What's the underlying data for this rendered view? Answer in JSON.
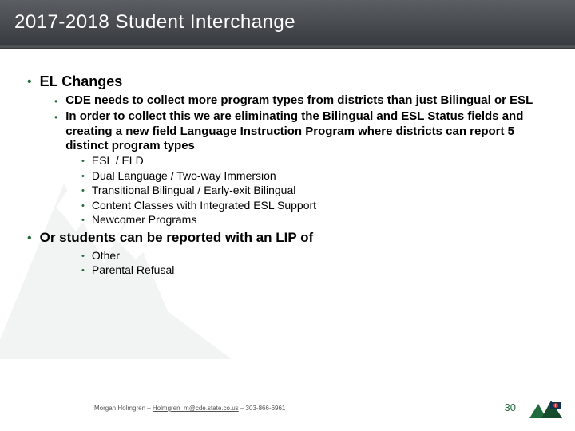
{
  "title": "2017-2018 Student Interchange",
  "bullets1": [
    {
      "text": "EL Changes"
    }
  ],
  "bullets2a": [
    {
      "text": "CDE needs to collect more program types from districts than just Bilingual or ESL"
    },
    {
      "text": "In order to collect this we are eliminating the Bilingual and ESL Status fields and creating a new field Language Instruction Program where districts can report 5 distinct program types"
    }
  ],
  "bullets3a": [
    {
      "text": "ESL / ELD"
    },
    {
      "text": "Dual Language / Two-way Immersion"
    },
    {
      "text": "Transitional Bilingual / Early-exit Bilingual"
    },
    {
      "text": "Content Classes with Integrated ESL Support"
    },
    {
      "text": "Newcomer Programs"
    }
  ],
  "bullets1b": [
    {
      "text": "Or students can be reported with an LIP of"
    }
  ],
  "bullets3b": [
    {
      "text": "Other"
    },
    {
      "text": "Parental Refusal",
      "underline": true
    }
  ],
  "footer": {
    "name": "Morgan Holmgren – ",
    "email": "Holmgren_m@cde.state.co.us",
    "phone": " – 303-866-6961"
  },
  "page": "30"
}
